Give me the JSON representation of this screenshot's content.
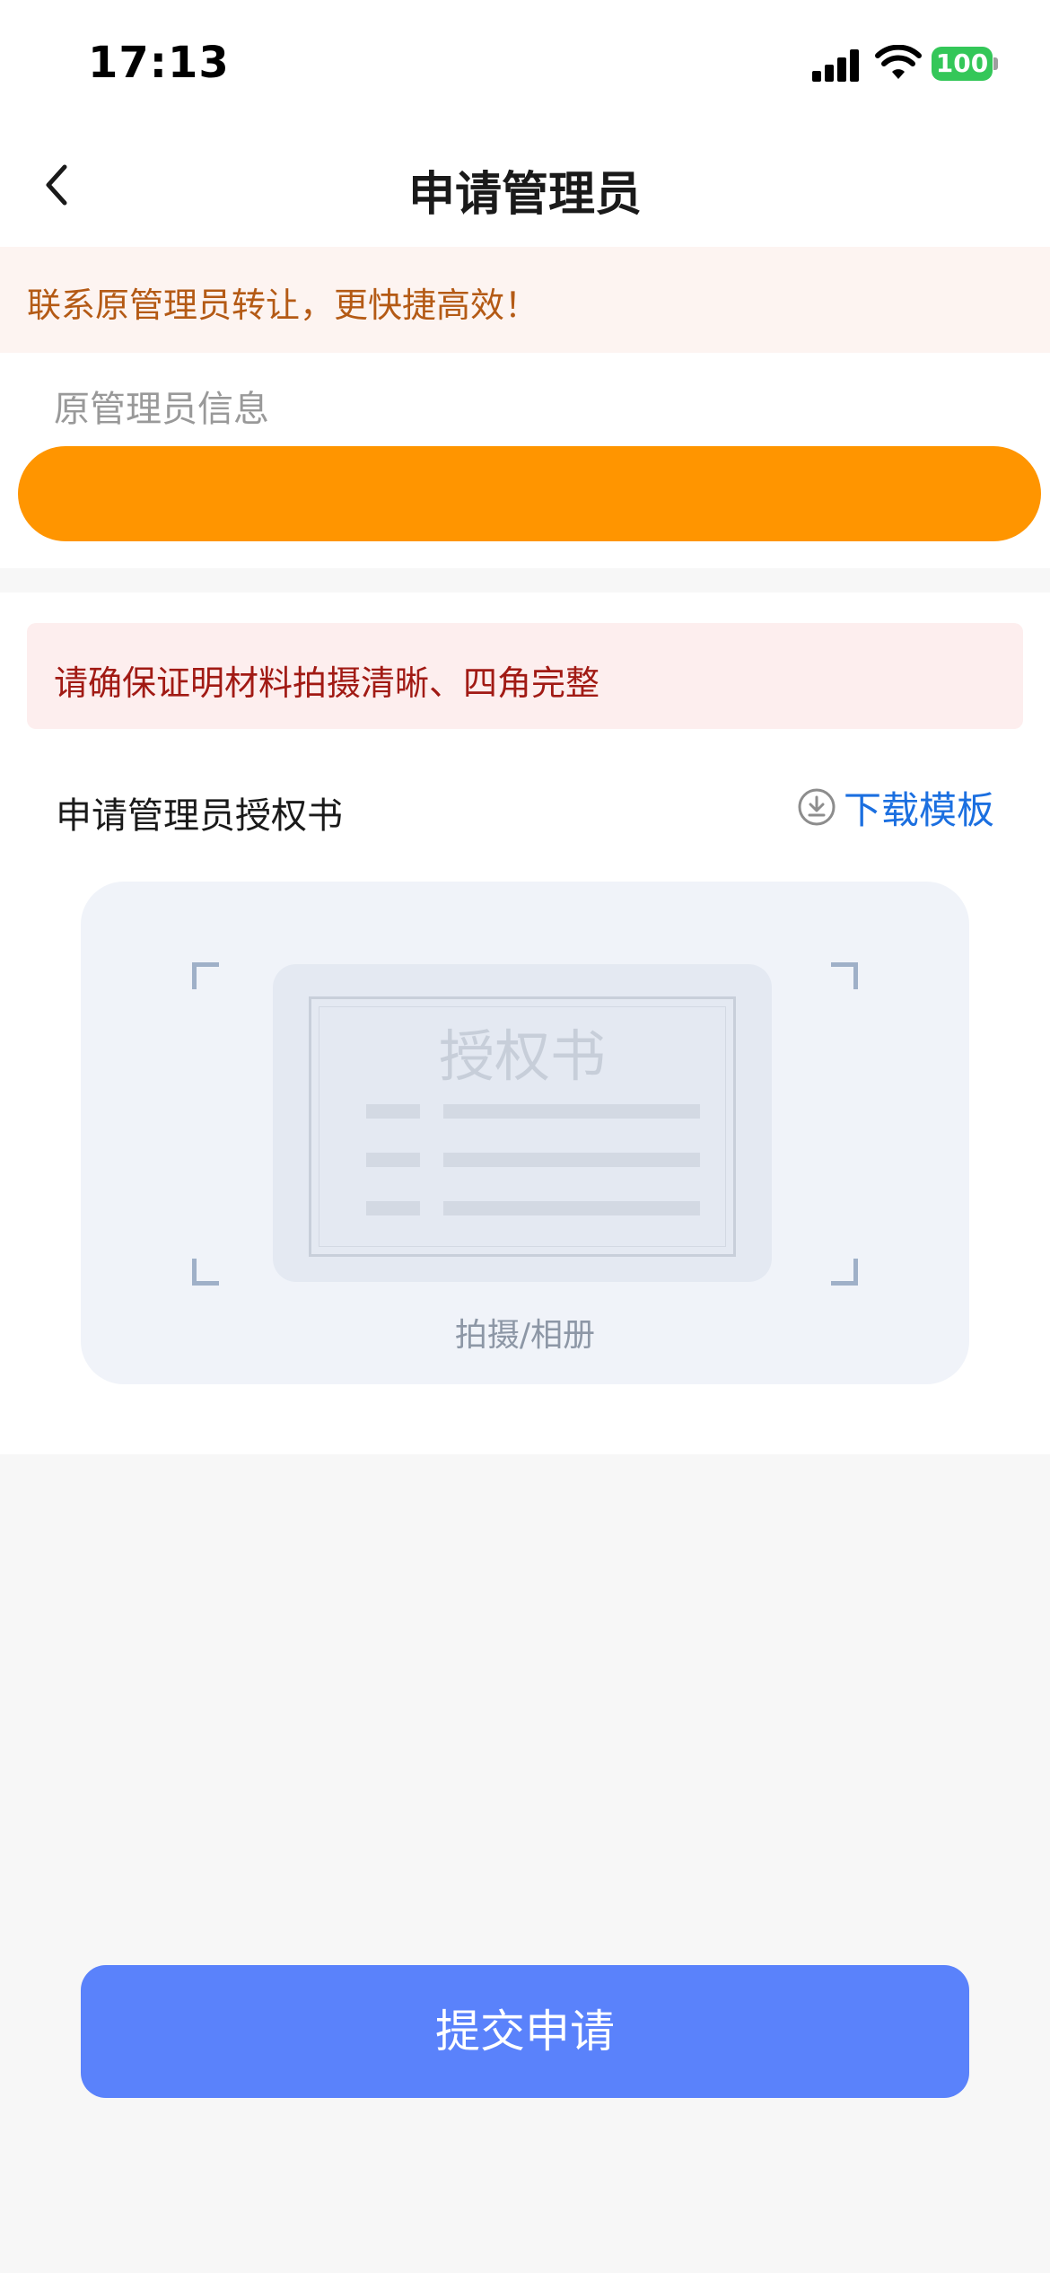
{
  "status_bar": {
    "time": "17:13",
    "battery_level": "100",
    "icons": [
      "signal-icon",
      "wifi-icon",
      "battery-icon"
    ]
  },
  "nav": {
    "title": "申请管理员",
    "back_icon": "chevron-left-icon"
  },
  "tip_banner": {
    "text": "联系原管理员转让，更快捷高效！"
  },
  "original_admin": {
    "label": "原管理员信息",
    "value": ""
  },
  "upload": {
    "warning": "请确保证明材料拍摄清晰、四角完整",
    "document_label": "申请管理员授权书",
    "download_label": "下载模板",
    "download_icon": "download-icon",
    "placeholder_title": "授权书",
    "caption": "拍摄/相册"
  },
  "submit": {
    "label": "提交申请"
  },
  "colors": {
    "accent_orange": "#ff9500",
    "submit_blue": "#5a82fb",
    "link_blue": "#1b6fe0",
    "warning_red": "#a11a14",
    "tip_orange": "#b45a15",
    "battery_green": "#34c759"
  }
}
